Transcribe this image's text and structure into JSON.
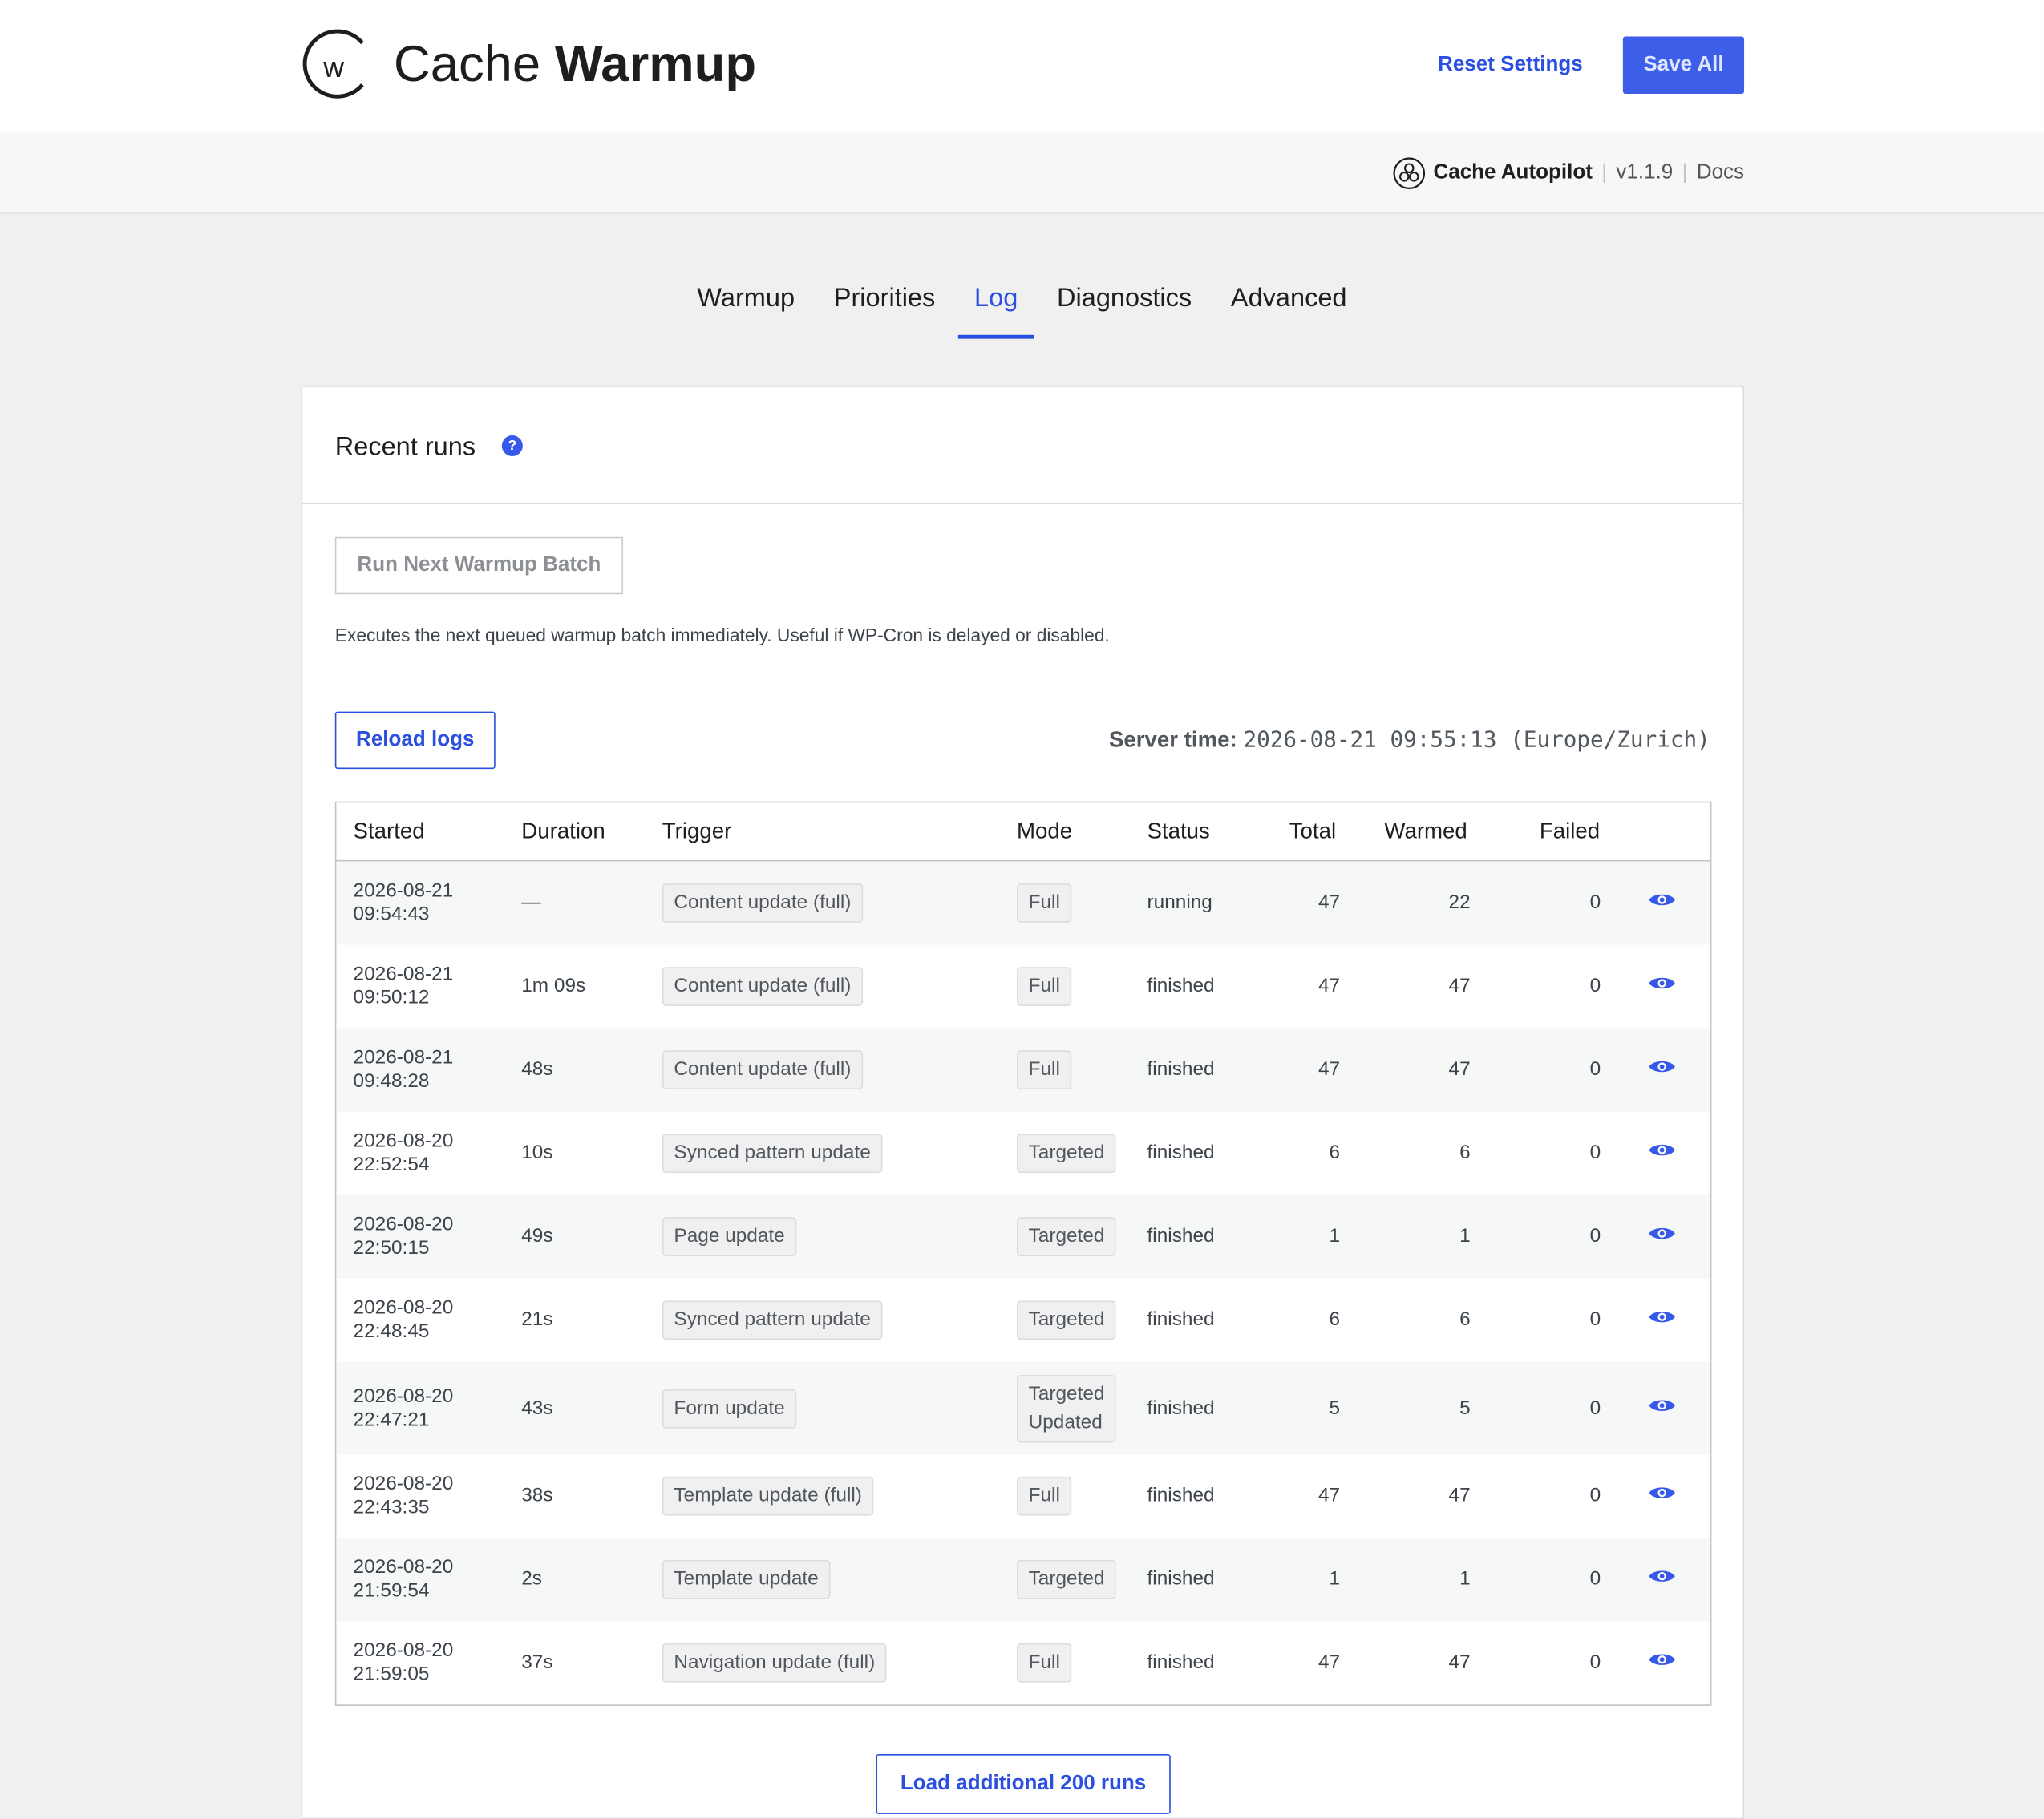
{
  "header": {
    "brand_light": "Cache",
    "brand_bold": "Warmup",
    "logo_letter": "w",
    "reset_label": "Reset Settings",
    "save_label": "Save All"
  },
  "subbar": {
    "product": "Cache Autopilot",
    "sep": "|",
    "version": "v1.1.9",
    "docs": "Docs"
  },
  "tabs": [
    {
      "label": "Warmup"
    },
    {
      "label": "Priorities"
    },
    {
      "label": "Log",
      "active": true
    },
    {
      "label": "Diagnostics"
    },
    {
      "label": "Advanced"
    }
  ],
  "card": {
    "title": "Recent runs",
    "help_glyph": "?",
    "run_batch_label": "Run Next Warmup Batch",
    "run_batch_desc": "Executes the next queued warmup batch immediately. Useful if WP-Cron is delayed or disabled.",
    "reload_label": "Reload logs",
    "server_time_label": "Server time:",
    "server_time_value": "2026-08-21 09:55:13 (Europe/Zurich)",
    "load_more_label": "Load additional 200 runs"
  },
  "table": {
    "columns": [
      "Started",
      "Duration",
      "Trigger",
      "Mode",
      "Status",
      "Total",
      "Warmed",
      "Failed"
    ],
    "rows": [
      {
        "date": "2026-08-21",
        "time": "09:54:43",
        "duration": "—",
        "trigger": "Content update (full)",
        "mode": "Full",
        "mode2": "",
        "status": "running",
        "total": "47",
        "warmed": "22",
        "failed": "0"
      },
      {
        "date": "2026-08-21",
        "time": "09:50:12",
        "duration": "1m 09s",
        "trigger": "Content update (full)",
        "mode": "Full",
        "mode2": "",
        "status": "finished",
        "total": "47",
        "warmed": "47",
        "failed": "0"
      },
      {
        "date": "2026-08-21",
        "time": "09:48:28",
        "duration": "48s",
        "trigger": "Content update (full)",
        "mode": "Full",
        "mode2": "",
        "status": "finished",
        "total": "47",
        "warmed": "47",
        "failed": "0"
      },
      {
        "date": "2026-08-20",
        "time": "22:52:54",
        "duration": "10s",
        "trigger": "Synced pattern update",
        "mode": "Targeted",
        "mode2": "",
        "status": "finished",
        "total": "6",
        "warmed": "6",
        "failed": "0"
      },
      {
        "date": "2026-08-20",
        "time": "22:50:15",
        "duration": "49s",
        "trigger": "Page update",
        "mode": "Targeted",
        "mode2": "",
        "status": "finished",
        "total": "1",
        "warmed": "1",
        "failed": "0"
      },
      {
        "date": "2026-08-20",
        "time": "22:48:45",
        "duration": "21s",
        "trigger": "Synced pattern update",
        "mode": "Targeted",
        "mode2": "",
        "status": "finished",
        "total": "6",
        "warmed": "6",
        "failed": "0"
      },
      {
        "date": "2026-08-20",
        "time": "22:47:21",
        "duration": "43s",
        "trigger": "Form update",
        "mode": "Targeted",
        "mode2": "Updated",
        "status": "finished",
        "total": "5",
        "warmed": "5",
        "failed": "0"
      },
      {
        "date": "2026-08-20",
        "time": "22:43:35",
        "duration": "38s",
        "trigger": "Template update (full)",
        "mode": "Full",
        "mode2": "",
        "status": "finished",
        "total": "47",
        "warmed": "47",
        "failed": "0"
      },
      {
        "date": "2026-08-20",
        "time": "21:59:54",
        "duration": "2s",
        "trigger": "Template update",
        "mode": "Targeted",
        "mode2": "",
        "status": "finished",
        "total": "1",
        "warmed": "1",
        "failed": "0"
      },
      {
        "date": "2026-08-20",
        "time": "21:59:05",
        "duration": "37s",
        "trigger": "Navigation update (full)",
        "mode": "Full",
        "mode2": "",
        "status": "finished",
        "total": "47",
        "warmed": "47",
        "failed": "0"
      }
    ]
  },
  "colors": {
    "accent": "#2b4fe0",
    "save_bg": "#3c5ee8",
    "page_bg": "#f0f0f1"
  },
  "icons": {
    "logo": "circle-w-logo-icon",
    "autopilot": "autopilot-icon",
    "help": "help-icon",
    "view": "eye-icon"
  }
}
